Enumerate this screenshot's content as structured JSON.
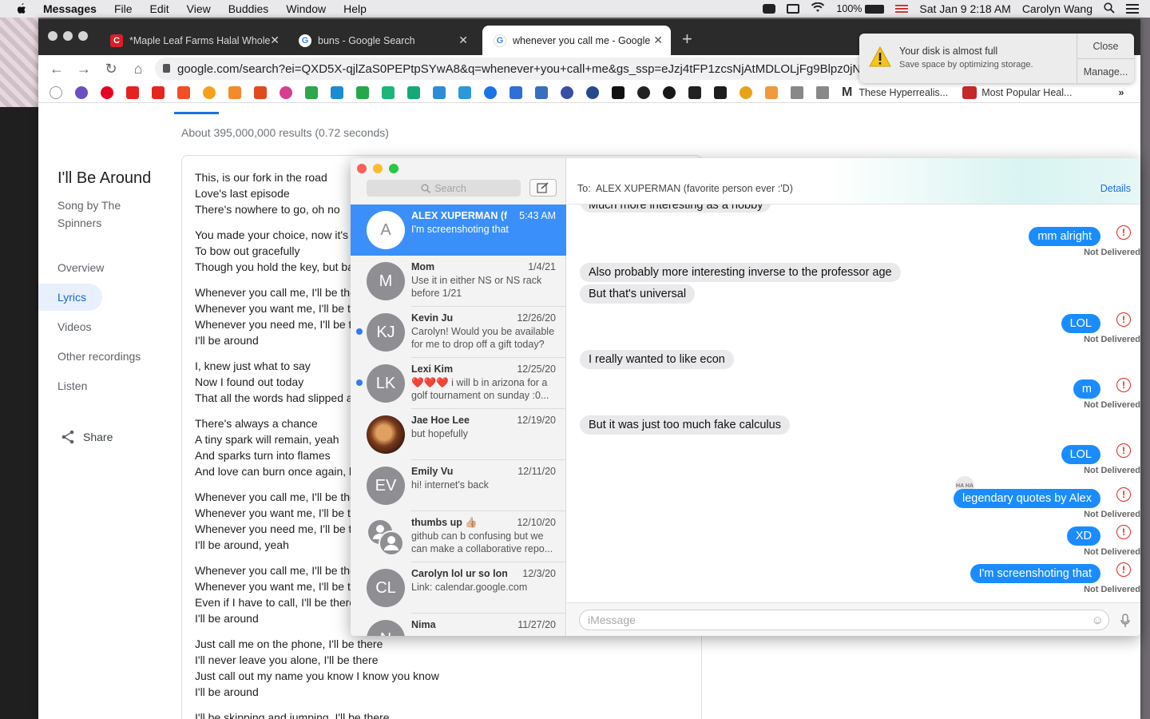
{
  "menubar": {
    "app": "Messages",
    "items": [
      "File",
      "Edit",
      "View",
      "Buddies",
      "Window",
      "Help"
    ],
    "battery": "100%",
    "datetime": "Sat Jan 9  2:18 AM",
    "user": "Carolyn Wang"
  },
  "browser": {
    "tabs": [
      {
        "title": "*Maple Leaf Farms Halal Whole",
        "icon": "C"
      },
      {
        "title": "buns - Google Search",
        "icon": "G"
      },
      {
        "title": "whenever you call me - Google",
        "icon": "G"
      }
    ],
    "url": "google.com/search?ei=QXD5X-qjlZaS0PEPtpSYwA8&q=whenever+you+call+me&gs_ssp=eJzj4tFP1zcsNjAtMDLOLjFg9Blpz0jNSy1L",
    "bookmark_labels": [
      "M",
      "These Hyperrealis...",
      "Most Popular Heal..."
    ]
  },
  "google": {
    "results": "About 395,000,000 results (0.72 seconds)",
    "title": "I'll Be Around",
    "subtitle": "Song by The Spinners",
    "nav": [
      "Overview",
      "Lyrics",
      "Videos",
      "Other recordings",
      "Listen"
    ],
    "share": "Share",
    "stanzas": [
      [
        "This, is our fork in the road",
        "Love's last episode",
        "There's nowhere to go, oh no"
      ],
      [
        "You made your choice, now it's",
        "To bow out gracefully",
        "Though you hold the key, but ba"
      ],
      [
        "Whenever you call me, I'll be the",
        "Whenever you want me, I'll be th",
        "Whenever you need me, I'll be th",
        "I'll be around"
      ],
      [
        "I, knew just what to say",
        "Now I found out today",
        "That all the words had slipped a"
      ],
      [
        "There's always a chance",
        "A tiny spark will remain, yeah",
        "And sparks turn into flames",
        "And love can burn once again, b"
      ],
      [
        "Whenever you call me, I'll be the",
        "Whenever you want me, I'll be th",
        "Whenever you need me, I'll be th",
        "I'll be around, yeah"
      ],
      [
        "Whenever you call me, I'll be the",
        "Whenever you want me, I'll be th",
        "Even if I have to call, I'll be there",
        "I'll be around"
      ],
      [
        "Just call me on the phone, I'll be there",
        "I'll never leave you alone, I'll be there",
        "Just call out my name you know I know you know",
        "I'll be around"
      ],
      [
        "I'll be skipping and jumping, I'll be there"
      ]
    ]
  },
  "notification": {
    "title": "Your disk is almost full",
    "subtitle": "Save space by optimizing storage.",
    "close": "Close",
    "manage": "Manage..."
  },
  "messages": {
    "search_placeholder": "Search",
    "conversations": [
      {
        "initials": "A",
        "name": "ALEX XUPERMAN (f...",
        "date": "5:43 AM",
        "preview": "I'm screenshoting that"
      },
      {
        "initials": "M",
        "name": "Mom",
        "date": "1/4/21",
        "preview": "Use it in either NS or NS rack before 1/21"
      },
      {
        "initials": "KJ",
        "name": "Kevin Ju",
        "date": "12/26/20",
        "preview": "Carolyn! Would you be available for me to drop off a gift today?"
      },
      {
        "initials": "LK",
        "name": "Lexi Kim",
        "date": "12/25/20",
        "preview": "❤️❤️❤️ i will b in arizona for a golf tournament on sunday :0..."
      },
      {
        "initials": "",
        "name": "Jae Hoe Lee",
        "date": "12/19/20",
        "preview": "but hopefully"
      },
      {
        "initials": "EV",
        "name": "Emily Vu",
        "date": "12/11/20",
        "preview": "hi! internet's back"
      },
      {
        "initials": "",
        "name": "thumbs up 👍🏼",
        "date": "12/10/20",
        "preview": "github can b confusing but we can make a collaborative repo..."
      },
      {
        "initials": "CL",
        "name": "Carolyn lol ur so lon...",
        "date": "12/3/20",
        "preview": "Link: calendar.google.com"
      },
      {
        "initials": "N",
        "name": "Nima",
        "date": "11/27/20",
        "preview": ""
      }
    ],
    "to_label": "To:",
    "recipient": "ALEX XUPERMAN (favorite person ever :'D)",
    "details": "Details",
    "not_delivered": "Not Delivered",
    "tapback": "HA HA",
    "thread": [
      {
        "dir": "in",
        "text": "Much more interesting as a hobby"
      },
      {
        "dir": "out",
        "text": "mm alright"
      },
      {
        "dir": "in",
        "text": "Also probably more interesting inverse to the professor age"
      },
      {
        "dir": "in",
        "text": "But that's universal"
      },
      {
        "dir": "out",
        "text": "LOL"
      },
      {
        "dir": "in",
        "text": "I really wanted to like econ"
      },
      {
        "dir": "out",
        "text": "m"
      },
      {
        "dir": "in",
        "text": "But it was just too much fake calculus"
      },
      {
        "dir": "out",
        "text": "LOL"
      },
      {
        "dir": "out",
        "text": "legendary quotes by Alex"
      },
      {
        "dir": "out",
        "text": "XD"
      },
      {
        "dir": "out",
        "text": "I'm screenshoting that"
      }
    ],
    "input_placeholder": "iMessage"
  }
}
